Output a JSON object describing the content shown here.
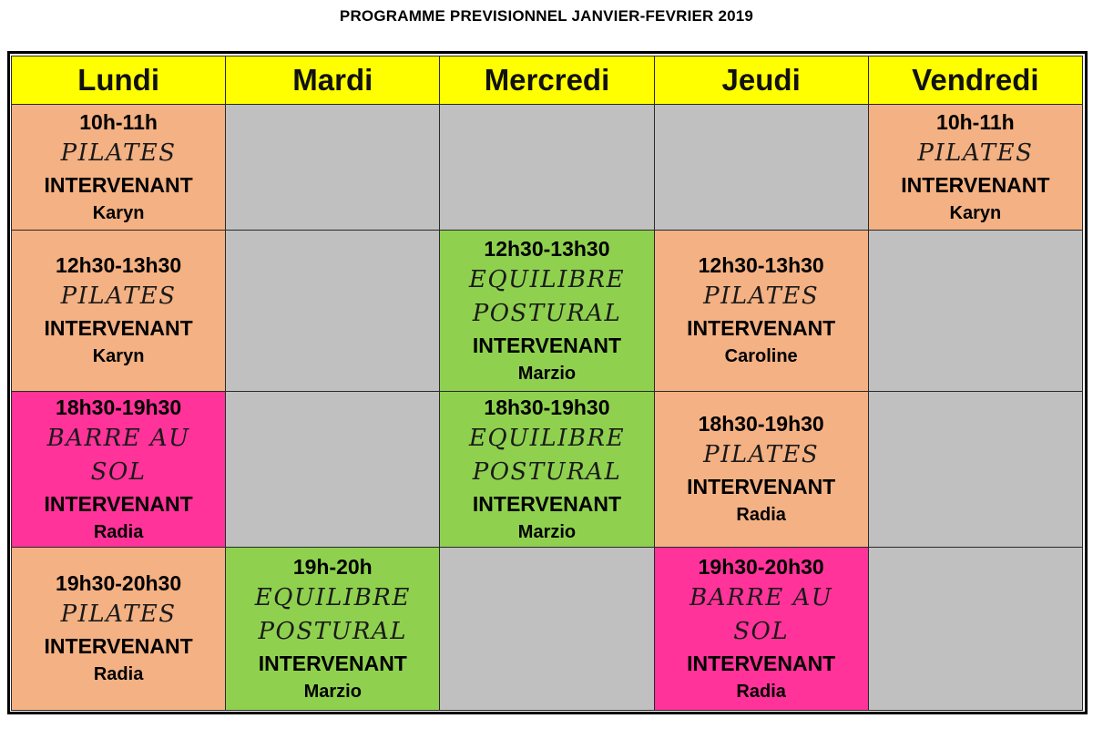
{
  "title": "PROGRAMME PREVISIONNEL JANVIER-FEVRIER 2019",
  "days": [
    "Lundi",
    "Mardi",
    "Mercredi",
    "Jeudi",
    "Vendredi"
  ],
  "colors": {
    "header": "#ffff00",
    "pilates": "#f4b183",
    "equilibre": "#8fd14f",
    "barre": "#ff3399",
    "empty": "#c0c0c0"
  },
  "rows": [
    [
      {
        "time": "10h-11h",
        "course": "PILATES",
        "label": "INTERVENANT",
        "name": "Karyn"
      },
      null,
      null,
      null,
      {
        "time": "10h-11h",
        "course": "PILATES",
        "label": "INTERVENANT",
        "name": "Karyn"
      }
    ],
    [
      {
        "time": "12h30-13h30",
        "course": "PILATES",
        "label": "INTERVENANT",
        "name": "Karyn"
      },
      null,
      {
        "time": "12h30-13h30",
        "course": "EQUILIBRE POSTURAL",
        "label": "INTERVENANT",
        "name": "Marzio"
      },
      {
        "time": "12h30-13h30",
        "course": "PILATES",
        "label": "INTERVENANT",
        "name": "Caroline"
      },
      null
    ],
    [
      {
        "time": "18h30-19h30",
        "course": "BARRE AU SOL",
        "label": "INTERVENANT",
        "name": "Radia"
      },
      null,
      {
        "time": "18h30-19h30",
        "course": "EQUILIBRE POSTURAL",
        "label": "INTERVENANT",
        "name": "Marzio"
      },
      {
        "time": "18h30-19h30",
        "course": "PILATES",
        "label": "INTERVENANT",
        "name": "Radia"
      },
      null
    ],
    [
      {
        "time": "19h30-20h30",
        "course": "PILATES",
        "label": "INTERVENANT",
        "name": "Radia"
      },
      {
        "time": "19h-20h",
        "course": "EQUILIBRE POSTURAL",
        "label": "INTERVENANT",
        "name": "Marzio"
      },
      null,
      {
        "time": "19h30-20h30",
        "course": "BARRE AU SOL",
        "label": "INTERVENANT",
        "name": "Radia"
      },
      null
    ]
  ]
}
